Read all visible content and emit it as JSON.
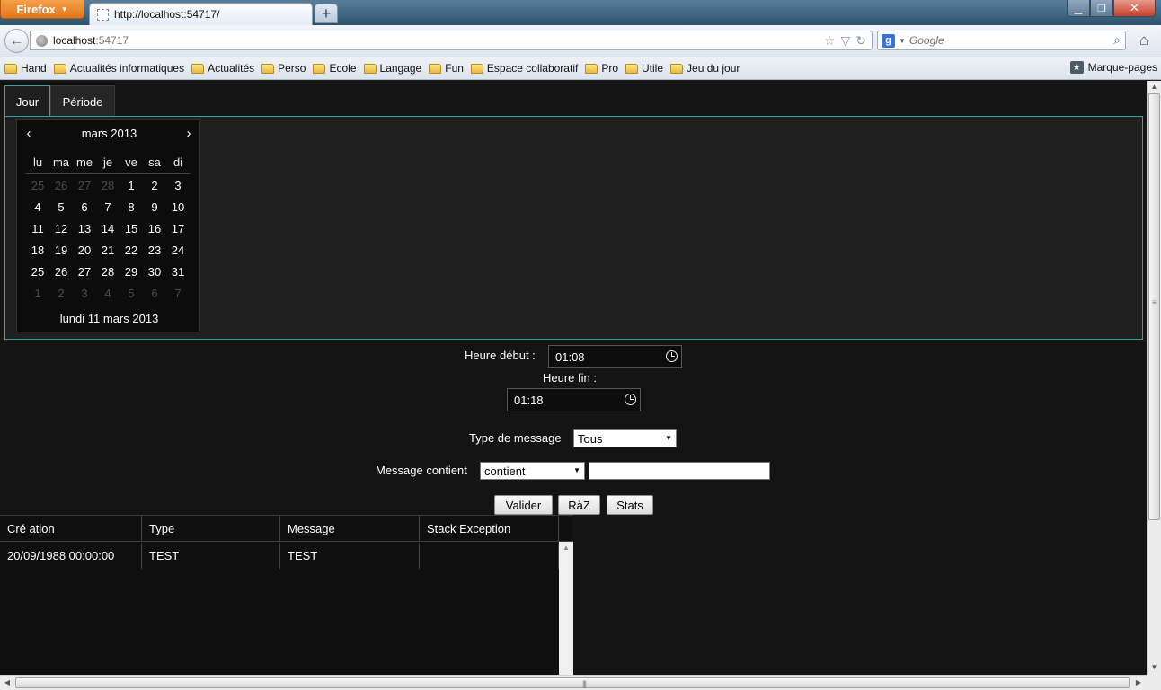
{
  "browser": {
    "app_button": "Firefox",
    "tab_title": "http://localhost:54717/",
    "new_tab": "+",
    "url_host": "localhost",
    "url_port": ":54717",
    "search_engine": "g",
    "search_placeholder": "Google",
    "bookmarks": [
      "Hand",
      "Actualités informatiques",
      "Actualités",
      "Perso",
      "Ecole",
      "Langage",
      "Fun",
      "Espace collaboratif",
      "Pro",
      "Utile",
      "Jeu du jour"
    ],
    "bookmarks_menu": "Marque-pages"
  },
  "tabs": {
    "jour": "Jour",
    "periode": "Période"
  },
  "calendar": {
    "month": "mars 2013",
    "prev": "‹",
    "next": "›",
    "weekdays": [
      "lu",
      "ma",
      "me",
      "je",
      "ve",
      "sa",
      "di"
    ],
    "weeks": [
      [
        {
          "d": "25",
          "o": true
        },
        {
          "d": "26",
          "o": true
        },
        {
          "d": "27",
          "o": true
        },
        {
          "d": "28",
          "o": true
        },
        {
          "d": "1",
          "o": false
        },
        {
          "d": "2",
          "o": false
        },
        {
          "d": "3",
          "o": false
        }
      ],
      [
        {
          "d": "4",
          "o": false
        },
        {
          "d": "5",
          "o": false
        },
        {
          "d": "6",
          "o": false
        },
        {
          "d": "7",
          "o": false
        },
        {
          "d": "8",
          "o": false
        },
        {
          "d": "9",
          "o": false
        },
        {
          "d": "10",
          "o": false
        }
      ],
      [
        {
          "d": "11",
          "o": false
        },
        {
          "d": "12",
          "o": false
        },
        {
          "d": "13",
          "o": false
        },
        {
          "d": "14",
          "o": false
        },
        {
          "d": "15",
          "o": false
        },
        {
          "d": "16",
          "o": false
        },
        {
          "d": "17",
          "o": false
        }
      ],
      [
        {
          "d": "18",
          "o": false
        },
        {
          "d": "19",
          "o": false
        },
        {
          "d": "20",
          "o": false
        },
        {
          "d": "21",
          "o": false
        },
        {
          "d": "22",
          "o": false
        },
        {
          "d": "23",
          "o": false
        },
        {
          "d": "24",
          "o": false
        }
      ],
      [
        {
          "d": "25",
          "o": false
        },
        {
          "d": "26",
          "o": false
        },
        {
          "d": "27",
          "o": false
        },
        {
          "d": "28",
          "o": false
        },
        {
          "d": "29",
          "o": false
        },
        {
          "d": "30",
          "o": false
        },
        {
          "d": "31",
          "o": false
        }
      ],
      [
        {
          "d": "1",
          "o": true
        },
        {
          "d": "2",
          "o": true
        },
        {
          "d": "3",
          "o": true
        },
        {
          "d": "4",
          "o": true
        },
        {
          "d": "5",
          "o": true
        },
        {
          "d": "6",
          "o": true
        },
        {
          "d": "7",
          "o": true
        }
      ]
    ],
    "selected_label": "lundi 11 mars 2013"
  },
  "form": {
    "start_label": "Heure début :",
    "start_value": "01:08",
    "end_label": "Heure fin :",
    "end_value": "01:18",
    "type_label": "Type de message",
    "type_value": "Tous",
    "contains_label": "Message contient",
    "contains_mode": "contient",
    "contains_text": "",
    "buttons": {
      "validate": "Valider",
      "reset": "RàZ",
      "stats": "Stats"
    }
  },
  "grid": {
    "columns": [
      "Cré ation",
      "Type",
      "Message",
      "Stack Exception"
    ],
    "rows": [
      [
        "20/09/1988 00:00:00",
        "TEST",
        "TEST",
        ""
      ]
    ]
  }
}
